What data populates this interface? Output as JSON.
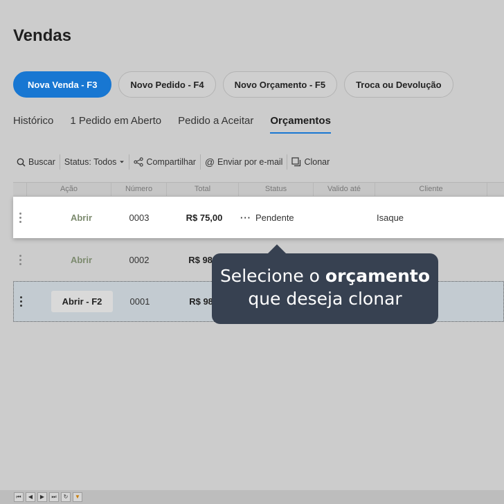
{
  "page": {
    "title": "Vendas"
  },
  "actions": [
    {
      "label": "Nova Venda - F3"
    },
    {
      "label": "Novo Pedido - F4"
    },
    {
      "label": "Novo Orçamento - F5"
    },
    {
      "label": "Troca ou Devolução"
    }
  ],
  "tabs": [
    {
      "label": "Histórico"
    },
    {
      "label": "1 Pedido em Aberto"
    },
    {
      "label": "Pedido a Aceitar"
    },
    {
      "label": "Orçamentos",
      "active": true
    }
  ],
  "toolbar": {
    "search": "Buscar",
    "status": "Status: Todos",
    "share": "Compartilhar",
    "email": "Enviar por e-mail",
    "clone": "Clonar"
  },
  "grid": {
    "columns": [
      "Ação",
      "Número",
      "Total",
      "Status",
      "Valido até",
      "Cliente"
    ],
    "rows": [
      {
        "action": "Abrir",
        "number": "0003",
        "total": "R$ 75,00",
        "status": "Pendente",
        "valid_until": "",
        "client": "Isaque"
      },
      {
        "action": "Abrir",
        "number": "0002",
        "total": "R$ 98,9",
        "status": "",
        "valid_until": "",
        "client": ""
      },
      {
        "action": "Abrir - F2",
        "number": "0001",
        "total": "R$ 98,9",
        "status": "",
        "valid_until": "",
        "client": ""
      }
    ]
  },
  "tooltip": {
    "pre": "Selecione o ",
    "bold": "orçamento",
    "line2": "que deseja clonar"
  },
  "colors": {
    "primary": "#1877d2",
    "tooltip_bg": "#374151",
    "background": "#cccccc"
  },
  "footer": {
    "nav_icons": [
      "first-icon",
      "prev-icon",
      "next-icon",
      "last-icon",
      "refresh-icon",
      "filter-icon"
    ]
  }
}
